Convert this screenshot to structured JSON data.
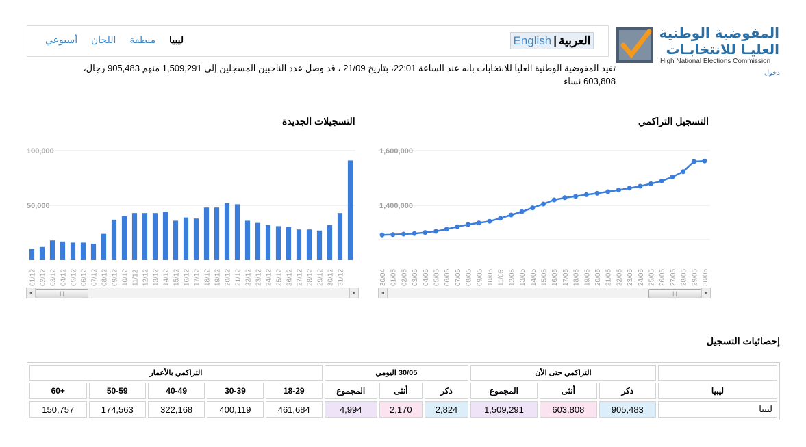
{
  "header": {
    "logo_ar_line1": "المفوضية الوطنية",
    "logo_ar_line2": "العليـا للانتخابـات",
    "logo_en": "High National Elections Commission",
    "login": "دخول"
  },
  "nav": {
    "items": [
      "ليبيا",
      "منطقة",
      "اللجان",
      "أسبوعي"
    ],
    "active": "ليبيا",
    "lang_en": "English",
    "lang_sep": "|",
    "lang_ar": "العربية"
  },
  "summary": "تفيد المفوضية الوطنية العليا للانتخابات بانه عند الساعة 22:01، بتاريخ 21/09 ، قد وصل عدد الناخبين المسجلين إلى 1,509,291 منهم 905,483 رجال، 603,808 نساء",
  "charts": {
    "cumulative_title": "التسجيل التراكمي",
    "daily_title": "التسجيلات الجديدة"
  },
  "chart_data": [
    {
      "type": "bar",
      "title": "التسجيلات الجديدة",
      "categories": [
        "01/12",
        "02/12",
        "03/12",
        "04/12",
        "05/12",
        "06/12",
        "07/12",
        "08/12",
        "09/12",
        "10/12",
        "11/12",
        "12/12",
        "13/12",
        "14/12",
        "15/12",
        "16/12",
        "17/12",
        "18/12",
        "19/12",
        "20/12",
        "21/12",
        "22/12",
        "23/12",
        "24/12",
        "25/12",
        "26/12",
        "27/12",
        "28/12",
        "29/12",
        "30/12",
        "31/12"
      ],
      "values": [
        10000,
        12000,
        18000,
        17000,
        16000,
        16000,
        15000,
        24000,
        37000,
        40000,
        43000,
        43000,
        43000,
        44000,
        36000,
        39000,
        38000,
        48000,
        48000,
        52000,
        51000,
        36000,
        34000,
        32000,
        31000,
        30000,
        28000,
        28000,
        27000,
        32000,
        43000,
        91000
      ],
      "ylim": [
        0,
        100000
      ],
      "yticks": [
        "100,000",
        "50,000"
      ],
      "colors": {
        "bar": "#3a7ddb"
      }
    },
    {
      "type": "line",
      "title": "التسجيل التراكمي",
      "categories": [
        "30/04",
        "01/05",
        "02/05",
        "03/05",
        "04/05",
        "05/05",
        "06/05",
        "07/05",
        "08/05",
        "09/05",
        "10/05",
        "11/05",
        "12/05",
        "13/05",
        "14/05",
        "15/05",
        "16/05",
        "17/05",
        "18/05",
        "19/05",
        "20/05",
        "21/05",
        "22/05",
        "23/05",
        "24/05",
        "25/05",
        "26/05",
        "27/05",
        "28/05",
        "29/05",
        "30/05"
      ],
      "values": [
        1292000,
        1293000,
        1295000,
        1297000,
        1301000,
        1305000,
        1313000,
        1322000,
        1330000,
        1336000,
        1342000,
        1353000,
        1365000,
        1377000,
        1391000,
        1405000,
        1420000,
        1428000,
        1433000,
        1439000,
        1444000,
        1450000,
        1456000,
        1463000,
        1470000,
        1479000,
        1489000,
        1504000,
        1523000,
        1560000,
        1562000
      ],
      "ylim": [
        1200000,
        1600000
      ],
      "yticks": [
        "1,600,000",
        "1,400,000"
      ],
      "colors": {
        "line": "#3a7ddb"
      }
    }
  ],
  "stats": {
    "title": "إحصائيات التسجيل",
    "group_headers": {
      "cumulative_now": "التراكمي حتى الأن",
      "daily": "30/05 اليومي",
      "by_age": "التراكمي بالأعمار"
    },
    "col_region": "ليبيا",
    "col_male": "ذكر",
    "col_female": "أنثى",
    "col_total": "المجموع",
    "age_groups": [
      "18-29",
      "30-39",
      "40-49",
      "50-59",
      "+60"
    ],
    "row": {
      "name": "ليبيا",
      "cum_male": "905,483",
      "cum_female": "603,808",
      "cum_total": "1,509,291",
      "day_male": "2,824",
      "day_female": "2,170",
      "day_total": "4,994",
      "ages": [
        "461,684",
        "400,119",
        "322,168",
        "174,563",
        "150,757"
      ]
    }
  }
}
